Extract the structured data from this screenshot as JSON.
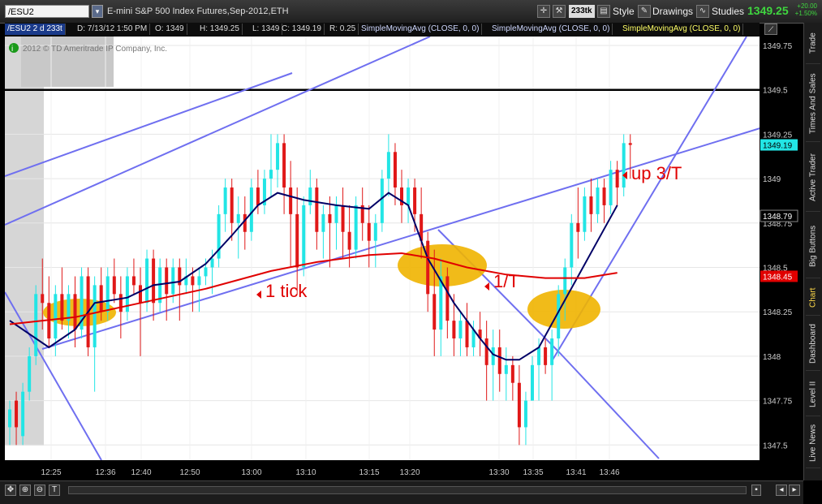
{
  "toolbar": {
    "symbol": "/ESU2",
    "description": "E-mini S&P 500 Index Futures,Sep-2012,ETH",
    "aggregation": "233tk",
    "style_label": "Style",
    "drawings_label": "Drawings",
    "studies_label": "Studies",
    "last_price": "1349.25",
    "change_abs": "+20.00",
    "change_pct": "+1.50%"
  },
  "infobar": {
    "symbol_period": "/ESU2 2 d 233t",
    "date": "D: 7/13/12 1:50 PM",
    "open": "O: 1349",
    "high": "H: 1349.25",
    "low": "L: 1349",
    "close": "C: 1349.19",
    "range": "R: 0.25",
    "sma1": "SimpleMovingAvg (CLOSE, 0, 0)",
    "sma2": "SimpleMovingAvg (CLOSE, 0, 0)",
    "sma3": "SimpleMovingAvg (CLOSE, 0, 0)"
  },
  "sidebar_tabs": [
    "Trade",
    "Times And Sales",
    "Active Trader",
    "Big Buttons",
    "Chart",
    "Dashboard",
    "Level II",
    "Live News"
  ],
  "sidebar_active": "Chart",
  "colors": {
    "up": "#22e5e5",
    "down": "#e01818",
    "sma_fast": "#000066",
    "sma_slow": "#e00000",
    "trendline": "#6f6ff0",
    "highlight": "#f0b400",
    "annotation": "#e00000",
    "price_tag_last": "#22e5e5",
    "price_tag_sma": "#e00000"
  },
  "chart_data": {
    "type": "candlestick",
    "watermark": "2012 © TD Ameritrade IP Company, Inc.",
    "ylim": [
      1347.3,
      1349.8
    ],
    "y_ticks": [
      "1349.75",
      "1349.5",
      "1349.25",
      "1349",
      "1348.75",
      "1348.5",
      "1348.25",
      "1348",
      "1347.75",
      "1347.5"
    ],
    "x_ticks": [
      "12:25",
      "12:36",
      "12:40",
      "12:50",
      "13:00",
      "13:10",
      "13:15",
      "13:20",
      "13:30",
      "13:35",
      "13:41",
      "13:46"
    ],
    "price_tags": [
      {
        "label": "1349.19",
        "value": 1349.19,
        "kind": "last"
      },
      {
        "label": "1348.79",
        "value": 1348.79,
        "kind": "plain"
      },
      {
        "label": "1348.45",
        "value": 1348.45,
        "kind": "sma"
      }
    ],
    "horizontal_line": 1349.5,
    "candles": [
      {
        "o": 1347.6,
        "h": 1347.75,
        "l": 1347.5,
        "c": 1347.7
      },
      {
        "o": 1347.75,
        "h": 1347.8,
        "l": 1347.5,
        "c": 1347.6
      },
      {
        "o": 1347.55,
        "h": 1347.85,
        "l": 1347.5,
        "c": 1347.8
      },
      {
        "o": 1347.8,
        "h": 1348.05,
        "l": 1347.75,
        "c": 1348.0
      },
      {
        "o": 1348.0,
        "h": 1348.4,
        "l": 1347.95,
        "c": 1348.35
      },
      {
        "o": 1348.35,
        "h": 1348.55,
        "l": 1348.15,
        "c": 1348.3
      },
      {
        "o": 1348.3,
        "h": 1348.45,
        "l": 1348.05,
        "c": 1348.1
      },
      {
        "o": 1348.1,
        "h": 1348.4,
        "l": 1348.0,
        "c": 1348.35
      },
      {
        "o": 1348.35,
        "h": 1348.5,
        "l": 1348.15,
        "c": 1348.2
      },
      {
        "o": 1348.2,
        "h": 1348.4,
        "l": 1348.1,
        "c": 1348.35
      },
      {
        "o": 1348.35,
        "h": 1348.45,
        "l": 1348.05,
        "c": 1348.15
      },
      {
        "o": 1348.15,
        "h": 1348.5,
        "l": 1348.1,
        "c": 1348.45
      },
      {
        "o": 1348.45,
        "h": 1348.5,
        "l": 1348.0,
        "c": 1348.05
      },
      {
        "o": 1348.05,
        "h": 1348.45,
        "l": 1347.8,
        "c": 1348.4
      },
      {
        "o": 1348.4,
        "h": 1348.5,
        "l": 1348.2,
        "c": 1348.25
      },
      {
        "o": 1348.25,
        "h": 1348.5,
        "l": 1348.2,
        "c": 1348.45
      },
      {
        "o": 1348.45,
        "h": 1348.55,
        "l": 1348.3,
        "c": 1348.35
      },
      {
        "o": 1348.35,
        "h": 1348.45,
        "l": 1348.1,
        "c": 1348.25
      },
      {
        "o": 1348.25,
        "h": 1348.5,
        "l": 1348.2,
        "c": 1348.45
      },
      {
        "o": 1348.45,
        "h": 1348.55,
        "l": 1348.35,
        "c": 1348.4
      },
      {
        "o": 1348.4,
        "h": 1348.5,
        "l": 1348.0,
        "c": 1348.3
      },
      {
        "o": 1348.3,
        "h": 1348.6,
        "l": 1348.25,
        "c": 1348.55
      },
      {
        "o": 1348.55,
        "h": 1348.6,
        "l": 1348.2,
        "c": 1348.3
      },
      {
        "o": 1348.3,
        "h": 1348.55,
        "l": 1348.25,
        "c": 1348.5
      },
      {
        "o": 1348.5,
        "h": 1348.55,
        "l": 1348.2,
        "c": 1348.35
      },
      {
        "o": 1348.35,
        "h": 1348.55,
        "l": 1348.3,
        "c": 1348.5
      },
      {
        "o": 1348.5,
        "h": 1348.55,
        "l": 1348.2,
        "c": 1348.4
      },
      {
        "o": 1348.4,
        "h": 1348.55,
        "l": 1348.35,
        "c": 1348.45
      },
      {
        "o": 1348.45,
        "h": 1348.5,
        "l": 1348.25,
        "c": 1348.4
      },
      {
        "o": 1348.4,
        "h": 1348.5,
        "l": 1348.25,
        "c": 1348.45
      },
      {
        "o": 1348.45,
        "h": 1348.55,
        "l": 1348.4,
        "c": 1348.5
      },
      {
        "o": 1348.5,
        "h": 1348.6,
        "l": 1348.35,
        "c": 1348.55
      },
      {
        "o": 1348.55,
        "h": 1348.85,
        "l": 1348.5,
        "c": 1348.8
      },
      {
        "o": 1348.8,
        "h": 1349.0,
        "l": 1348.7,
        "c": 1348.95
      },
      {
        "o": 1348.95,
        "h": 1349.0,
        "l": 1348.65,
        "c": 1348.75
      },
      {
        "o": 1348.75,
        "h": 1348.9,
        "l": 1348.55,
        "c": 1348.8
      },
      {
        "o": 1348.8,
        "h": 1348.9,
        "l": 1348.6,
        "c": 1348.7
      },
      {
        "o": 1348.7,
        "h": 1349.0,
        "l": 1348.65,
        "c": 1348.95
      },
      {
        "o": 1348.95,
        "h": 1349.05,
        "l": 1348.8,
        "c": 1348.85
      },
      {
        "o": 1348.85,
        "h": 1349.05,
        "l": 1348.8,
        "c": 1349.0
      },
      {
        "o": 1349.0,
        "h": 1349.25,
        "l": 1348.9,
        "c": 1349.05
      },
      {
        "o": 1349.05,
        "h": 1349.25,
        "l": 1348.95,
        "c": 1349.2
      },
      {
        "o": 1349.2,
        "h": 1349.25,
        "l": 1348.8,
        "c": 1348.95
      },
      {
        "o": 1348.95,
        "h": 1349.1,
        "l": 1348.5,
        "c": 1348.8
      },
      {
        "o": 1348.8,
        "h": 1348.95,
        "l": 1348.35,
        "c": 1348.5
      },
      {
        "o": 1348.5,
        "h": 1348.9,
        "l": 1348.45,
        "c": 1348.85
      },
      {
        "o": 1348.85,
        "h": 1349.05,
        "l": 1348.8,
        "c": 1348.95
      },
      {
        "o": 1348.95,
        "h": 1349.0,
        "l": 1348.6,
        "c": 1348.7
      },
      {
        "o": 1348.7,
        "h": 1348.85,
        "l": 1348.55,
        "c": 1348.8
      },
      {
        "o": 1348.8,
        "h": 1348.9,
        "l": 1348.5,
        "c": 1348.75
      },
      {
        "o": 1348.75,
        "h": 1348.9,
        "l": 1348.6,
        "c": 1348.85
      },
      {
        "o": 1348.85,
        "h": 1348.95,
        "l": 1348.55,
        "c": 1348.7
      },
      {
        "o": 1348.7,
        "h": 1348.85,
        "l": 1348.5,
        "c": 1348.6
      },
      {
        "o": 1348.6,
        "h": 1348.9,
        "l": 1348.55,
        "c": 1348.85
      },
      {
        "o": 1348.85,
        "h": 1348.95,
        "l": 1348.65,
        "c": 1348.75
      },
      {
        "o": 1348.75,
        "h": 1348.85,
        "l": 1348.5,
        "c": 1348.65
      },
      {
        "o": 1348.65,
        "h": 1348.8,
        "l": 1348.5,
        "c": 1348.75
      },
      {
        "o": 1348.75,
        "h": 1349.05,
        "l": 1348.7,
        "c": 1349.0
      },
      {
        "o": 1349.0,
        "h": 1349.25,
        "l": 1348.9,
        "c": 1349.15
      },
      {
        "o": 1349.15,
        "h": 1349.2,
        "l": 1348.85,
        "c": 1348.95
      },
      {
        "o": 1348.95,
        "h": 1349.05,
        "l": 1348.75,
        "c": 1348.85
      },
      {
        "o": 1348.85,
        "h": 1349.0,
        "l": 1348.75,
        "c": 1348.95
      },
      {
        "o": 1348.95,
        "h": 1349.0,
        "l": 1348.7,
        "c": 1348.8
      },
      {
        "o": 1348.8,
        "h": 1348.95,
        "l": 1348.55,
        "c": 1348.65
      },
      {
        "o": 1348.65,
        "h": 1348.7,
        "l": 1348.25,
        "c": 1348.35
      },
      {
        "o": 1348.35,
        "h": 1348.6,
        "l": 1348.0,
        "c": 1348.15
      },
      {
        "o": 1348.15,
        "h": 1348.55,
        "l": 1348.0,
        "c": 1348.45
      },
      {
        "o": 1348.45,
        "h": 1348.5,
        "l": 1348.1,
        "c": 1348.2
      },
      {
        "o": 1348.2,
        "h": 1348.35,
        "l": 1348.0,
        "c": 1348.1
      },
      {
        "o": 1348.1,
        "h": 1348.25,
        "l": 1348.0,
        "c": 1348.2
      },
      {
        "o": 1348.2,
        "h": 1348.3,
        "l": 1348.0,
        "c": 1348.05
      },
      {
        "o": 1348.05,
        "h": 1348.2,
        "l": 1348.0,
        "c": 1348.15
      },
      {
        "o": 1348.15,
        "h": 1348.25,
        "l": 1348.0,
        "c": 1348.1
      },
      {
        "o": 1348.1,
        "h": 1348.2,
        "l": 1347.75,
        "c": 1347.95
      },
      {
        "o": 1347.95,
        "h": 1348.15,
        "l": 1347.75,
        "c": 1348.05
      },
      {
        "o": 1348.05,
        "h": 1348.15,
        "l": 1347.8,
        "c": 1347.9
      },
      {
        "o": 1347.9,
        "h": 1348.05,
        "l": 1347.75,
        "c": 1347.95
      },
      {
        "o": 1347.95,
        "h": 1348.0,
        "l": 1347.75,
        "c": 1347.85
      },
      {
        "o": 1347.85,
        "h": 1347.95,
        "l": 1347.5,
        "c": 1347.6
      },
      {
        "o": 1347.6,
        "h": 1347.8,
        "l": 1347.5,
        "c": 1347.75
      },
      {
        "o": 1347.75,
        "h": 1348.0,
        "l": 1347.75,
        "c": 1347.95
      },
      {
        "o": 1347.95,
        "h": 1348.1,
        "l": 1347.75,
        "c": 1348.05
      },
      {
        "o": 1348.05,
        "h": 1348.1,
        "l": 1347.9,
        "c": 1347.95
      },
      {
        "o": 1347.95,
        "h": 1348.15,
        "l": 1347.75,
        "c": 1348.1
      },
      {
        "o": 1348.1,
        "h": 1348.4,
        "l": 1348.0,
        "c": 1348.35
      },
      {
        "o": 1348.35,
        "h": 1348.55,
        "l": 1348.2,
        "c": 1348.5
      },
      {
        "o": 1348.5,
        "h": 1348.8,
        "l": 1348.4,
        "c": 1348.75
      },
      {
        "o": 1348.75,
        "h": 1348.95,
        "l": 1348.55,
        "c": 1348.7
      },
      {
        "o": 1348.7,
        "h": 1348.95,
        "l": 1348.65,
        "c": 1348.9
      },
      {
        "o": 1348.9,
        "h": 1349.0,
        "l": 1348.7,
        "c": 1348.8
      },
      {
        "o": 1348.8,
        "h": 1349.0,
        "l": 1348.75,
        "c": 1348.95
      },
      {
        "o": 1348.95,
        "h": 1349.0,
        "l": 1348.75,
        "c": 1348.85
      },
      {
        "o": 1348.85,
        "h": 1349.1,
        "l": 1348.8,
        "c": 1349.05
      },
      {
        "o": 1349.05,
        "h": 1349.1,
        "l": 1348.85,
        "c": 1348.95
      },
      {
        "o": 1348.95,
        "h": 1349.25,
        "l": 1348.9,
        "c": 1349.2
      },
      {
        "o": 1349.2,
        "h": 1349.25,
        "l": 1349.0,
        "c": 1349.19
      }
    ],
    "series": [
      {
        "name": "SimpleMovingAvg",
        "role": "fast",
        "values": [
          [
            0,
            1348.2
          ],
          [
            6,
            1348.05
          ],
          [
            10,
            1348.15
          ],
          [
            13,
            1348.3
          ],
          [
            18,
            1348.33
          ],
          [
            22,
            1348.4
          ],
          [
            26,
            1348.42
          ],
          [
            30,
            1348.52
          ],
          [
            34,
            1348.68
          ],
          [
            38,
            1348.85
          ],
          [
            41,
            1348.92
          ],
          [
            45,
            1348.88
          ],
          [
            50,
            1348.85
          ],
          [
            55,
            1348.83
          ],
          [
            58,
            1348.92
          ],
          [
            61,
            1348.85
          ],
          [
            64,
            1348.55
          ],
          [
            68,
            1348.3
          ],
          [
            72,
            1348.1
          ],
          [
            74,
            1348.01
          ],
          [
            76,
            1347.98
          ],
          [
            78,
            1347.98
          ],
          [
            81,
            1348.05
          ],
          [
            84,
            1348.25
          ],
          [
            87,
            1348.45
          ],
          [
            90,
            1348.65
          ],
          [
            93,
            1348.85
          ]
        ]
      },
      {
        "name": "SimpleMovingAvg",
        "role": "slow",
        "values": [
          [
            0,
            1348.18
          ],
          [
            10,
            1348.22
          ],
          [
            20,
            1348.3
          ],
          [
            30,
            1348.38
          ],
          [
            40,
            1348.48
          ],
          [
            47,
            1348.53
          ],
          [
            55,
            1348.57
          ],
          [
            60,
            1348.58
          ],
          [
            65,
            1348.55
          ],
          [
            70,
            1348.5
          ],
          [
            76,
            1348.46
          ],
          [
            82,
            1348.44
          ],
          [
            88,
            1348.44
          ],
          [
            93,
            1348.47
          ]
        ]
      }
    ],
    "annotations": [
      {
        "text": "1 tick"
      },
      {
        "text": "1/T"
      },
      {
        "text": "up 3/T"
      }
    ]
  }
}
